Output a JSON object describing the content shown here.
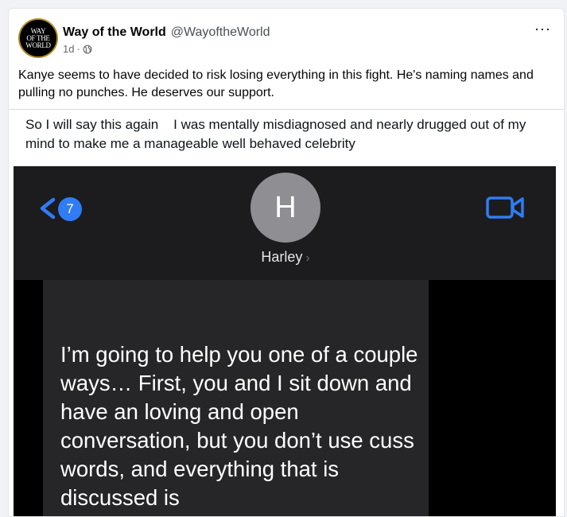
{
  "post": {
    "page_name": "Way of the World",
    "handle": "@WayoftheWorld",
    "time": "1d",
    "separator": "·",
    "avatar_lines": [
      "WAY",
      "OF THE",
      "WORLD"
    ],
    "more_label": "···",
    "text": "Kanye seems to have decided to risk losing everything in this fight. He's naming names and pulling no punches. He deserves our support."
  },
  "embedded": {
    "quote": "So I will say this again    I was mentally misdiagnosed and nearly drugged out of my mind to make me a manageable well behaved celebrity"
  },
  "screenshot": {
    "unread_count": "7",
    "contact_initial": "H",
    "contact_name": "Harley",
    "contact_chevron": "›",
    "message": "I’m going to help you one of a couple ways… First, you and I sit down and have an loving and open  conversation, but you don’t use cuss words, and everything that is discussed is",
    "colors": {
      "ios_blue": "#2f7cf6",
      "header_bg": "#1c1c1e",
      "bubble_bg": "#262628"
    }
  },
  "icons": {
    "globe": "globe-icon",
    "back": "chevron-left-icon",
    "video": "video-camera-icon"
  }
}
